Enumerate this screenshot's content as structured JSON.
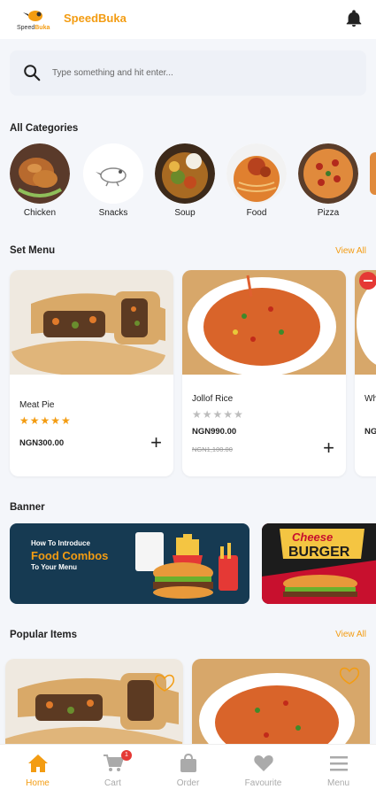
{
  "app": {
    "brand": "SpeedBuka",
    "logo_text": "SpeedBuka"
  },
  "search": {
    "placeholder": "Type something and hit enter..."
  },
  "categories": {
    "title": "All Categories",
    "items": [
      {
        "label": "Chicken"
      },
      {
        "label": "Snacks"
      },
      {
        "label": "Soup"
      },
      {
        "label": "Food"
      },
      {
        "label": "Pizza"
      }
    ]
  },
  "set_menu": {
    "title": "Set Menu",
    "view_all": "View All",
    "items": [
      {
        "name": "Meat Pie",
        "rating": 5,
        "price": "NGN300.00",
        "old_price": ""
      },
      {
        "name": "Jollof Rice",
        "rating": 0,
        "price": "NGN990.00",
        "old_price": "NGN1,100.00"
      },
      {
        "name": "Wh",
        "price": "NG"
      }
    ]
  },
  "banner": {
    "title": "Banner",
    "items": [
      {
        "line1": "How To Introduce",
        "line2": "Food Combos",
        "line3": "To Your Menu"
      },
      {
        "line1": "Cheese",
        "line2": "BURGER"
      }
    ]
  },
  "popular": {
    "title": "Popular Items",
    "view_all": "View All"
  },
  "nav": {
    "items": [
      {
        "label": "Home",
        "icon": "home-icon",
        "active": true
      },
      {
        "label": "Cart",
        "icon": "cart-icon",
        "badge": "1"
      },
      {
        "label": "Order",
        "icon": "bag-icon"
      },
      {
        "label": "Favourite",
        "icon": "heart-icon"
      },
      {
        "label": "Menu",
        "icon": "menu-icon"
      }
    ]
  },
  "colors": {
    "accent": "#f39c12",
    "badge": "#e53935",
    "star_filled": "#f39c12",
    "star_empty": "#bdbdbd"
  }
}
